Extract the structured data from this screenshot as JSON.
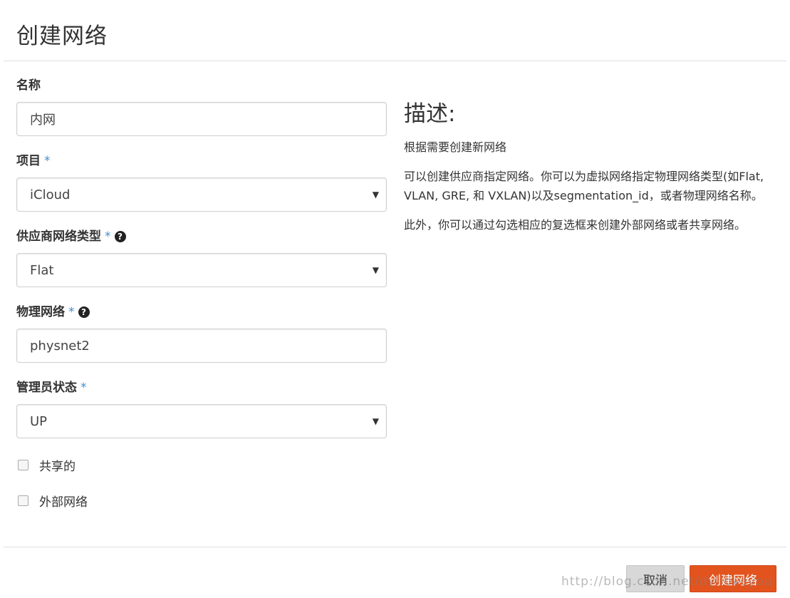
{
  "dialog": {
    "title": "创建网络"
  },
  "form": {
    "name": {
      "label": "名称",
      "value": "内网"
    },
    "project": {
      "label": "项目",
      "required_mark": "*",
      "value": "iCloud"
    },
    "provider_network_type": {
      "label": "供应商网络类型",
      "required_mark": "*",
      "value": "Flat",
      "help_icon": "question-circle-icon"
    },
    "physical_network": {
      "label": "物理网络",
      "required_mark": "*",
      "value": "physnet2",
      "help_icon": "question-circle-icon"
    },
    "admin_state": {
      "label": "管理员状态",
      "required_mark": "*",
      "value": "UP"
    },
    "shared": {
      "label": "共享的",
      "checked": false
    },
    "external": {
      "label": "外部网络",
      "checked": false
    }
  },
  "description": {
    "title": "描述:",
    "paragraphs": [
      "根据需要创建新网络",
      "可以创建供应商指定网络。你可以为虚拟网络指定物理网络类型(如Flat, VLAN, GRE, 和 VXLAN)以及segmentation_id，或者物理网络名称。",
      "此外，你可以通过勾选相应的复选框来创建外部网络或者共享网络。"
    ]
  },
  "footer": {
    "cancel_label": "取消",
    "submit_label": "创建网络"
  },
  "watermark": "http://blog.csdn.net/dylloveyou",
  "colors": {
    "accent": "#e2531e",
    "required": "#3e8ed0",
    "cancel_bg": "#d8d8d8"
  }
}
